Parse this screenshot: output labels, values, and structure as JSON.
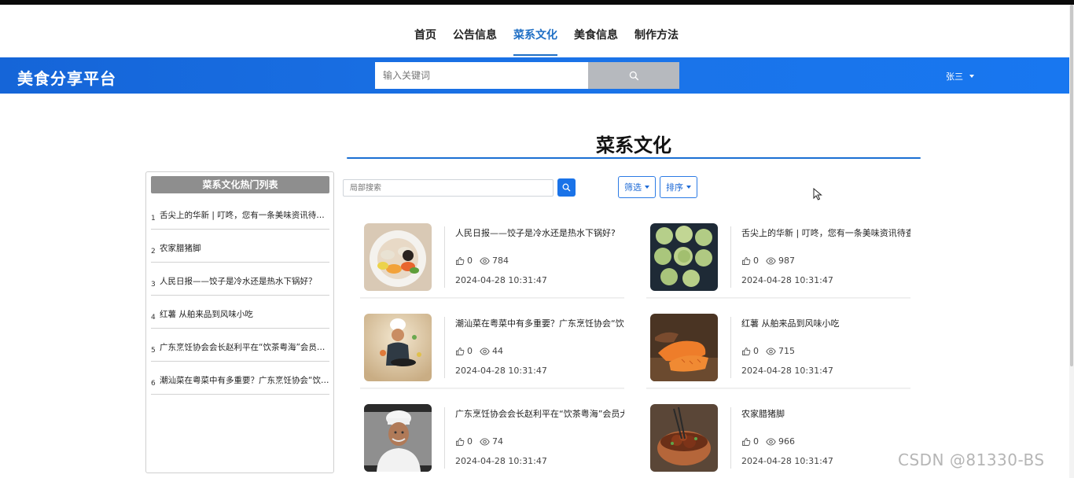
{
  "nav": {
    "items": [
      {
        "label": "首页",
        "active": false
      },
      {
        "label": "公告信息",
        "active": false
      },
      {
        "label": "菜系文化",
        "active": true
      },
      {
        "label": "美食信息",
        "active": false
      },
      {
        "label": "制作方法",
        "active": false
      }
    ]
  },
  "header": {
    "brand": "美食分享平台",
    "search_placeholder": "输入关键词",
    "user_name": "张三"
  },
  "page": {
    "title": "菜系文化"
  },
  "sidebar": {
    "title": "菜系文化热门列表",
    "items": [
      {
        "num": "1",
        "text": "舌尖上的华新 | 叮咚，您有一条美味资讯待查收"
      },
      {
        "num": "2",
        "text": "农家腊猪脚"
      },
      {
        "num": "3",
        "text": "人民日报——饺子是冷水还是热水下锅好？"
      },
      {
        "num": "4",
        "text": "红薯 从舶来品到风味小吃"
      },
      {
        "num": "5",
        "text": "广东烹饪协会会长赵利平在“饮茶粤海”会员大会上讲话"
      },
      {
        "num": "6",
        "text": "潮汕菜在粤菜中有多重要？广东烹饪协会“饮茶粤海”"
      }
    ]
  },
  "toolbar": {
    "local_search_placeholder": "局部搜索",
    "filter_label": "筛选",
    "sort_label": "排序"
  },
  "cards": [
    {
      "title": "人民日报——饺子是冷水还是热水下锅好?",
      "likes": "0",
      "views": "784",
      "date": "2024-04-28 10:31:47",
      "image": "dumplings-plate"
    },
    {
      "title": "舌尖上的华新 | 叮咚，您有一条美味资讯待查收",
      "likes": "0",
      "views": "987",
      "date": "2024-04-28 10:31:47",
      "image": "green-cakes"
    },
    {
      "title": "潮汕菜在粤菜中有多重要？广东烹饪协会“饮茶粤海”",
      "likes": "0",
      "views": "44",
      "date": "2024-04-28 10:31:47",
      "image": "chef-wok"
    },
    {
      "title": "红薯 从舶来品到风味小吃",
      "likes": "0",
      "views": "715",
      "date": "2024-04-28 10:31:47",
      "image": "sweet-potato"
    },
    {
      "title": "广东烹饪协会会长赵利平在“饮茶粤海”会员大会",
      "likes": "0",
      "views": "74",
      "date": "2024-04-28 10:31:47",
      "image": "chef-portrait"
    },
    {
      "title": "农家腊猪脚",
      "likes": "0",
      "views": "966",
      "date": "2024-04-28 10:31:47",
      "image": "pork-pot"
    }
  ],
  "watermark": "CSDN @81330-BS",
  "colors": {
    "primary": "#1a73e8",
    "active_nav": "#1f6fc5",
    "search_button": "#b6b9be"
  }
}
